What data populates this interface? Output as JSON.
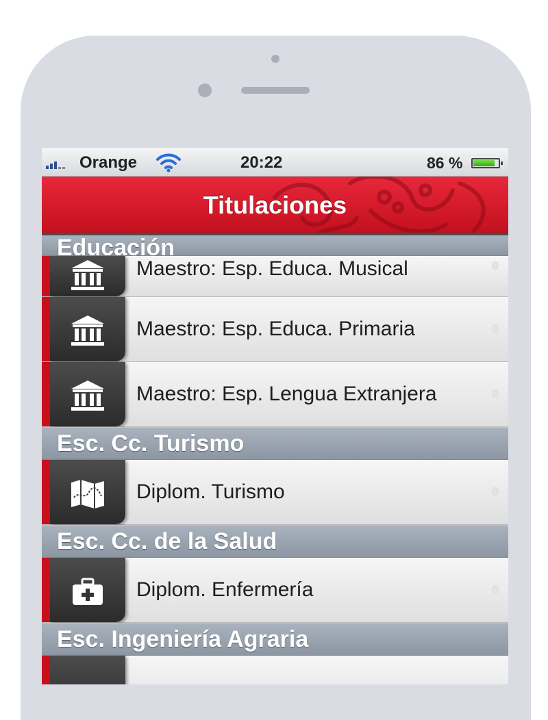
{
  "status_bar": {
    "carrier": "Orange",
    "time": "20:22",
    "battery_percent": "86 %",
    "battery_level": 0.86
  },
  "nav_bar": {
    "title": "Titulaciones",
    "accent_color": "#d81a2b"
  },
  "sections": [
    {
      "header": "Educación",
      "rows": [
        {
          "label": "Maestro: Esp. Educa. Musical",
          "icon": "building-icon"
        },
        {
          "label": "Maestro: Esp. Educa. Primaria",
          "icon": "building-icon"
        },
        {
          "label": "Maestro: Esp. Lengua Extranjera",
          "icon": "building-icon"
        }
      ]
    },
    {
      "header": "Esc. Cc. Turismo",
      "rows": [
        {
          "label": "Diplom. Turismo",
          "icon": "map-icon"
        }
      ]
    },
    {
      "header": "Esc. Cc. de la Salud",
      "rows": [
        {
          "label": "Diplom. Enfermería",
          "icon": "medical-kit-icon"
        }
      ]
    },
    {
      "header": "Esc. Ingeniería Agraria",
      "rows": []
    }
  ]
}
